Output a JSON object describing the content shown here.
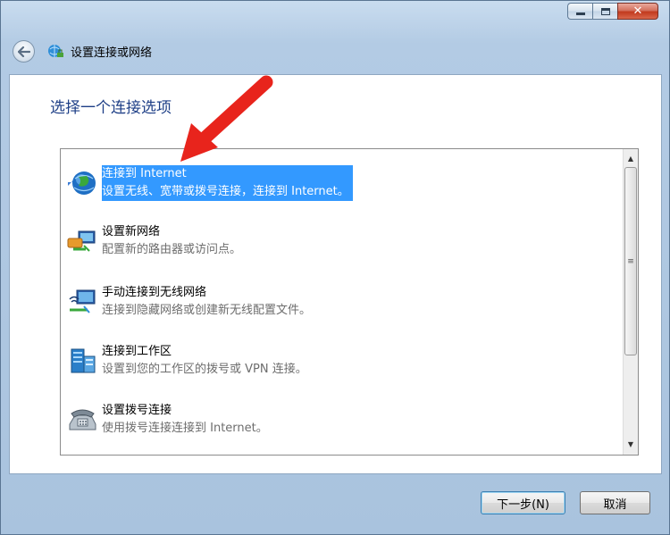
{
  "window": {
    "title": "设置连接或网络",
    "controls": {
      "minimize": "minimize-icon",
      "maximize": "maximize-icon",
      "close": "✕"
    }
  },
  "nav": {
    "back_icon": "back-arrow-icon",
    "title_icon": "network-setup-icon"
  },
  "main": {
    "heading": "选择一个连接选项",
    "options": [
      {
        "title": "连接到 Internet",
        "desc": "设置无线、宽带或拨号连接，连接到 Internet。",
        "icon": "globe-icon",
        "selected": true
      },
      {
        "title": "设置新网络",
        "desc": "配置新的路由器或访问点。",
        "icon": "router-icon",
        "selected": false
      },
      {
        "title": "手动连接到无线网络",
        "desc": "连接到隐藏网络或创建新无线配置文件。",
        "icon": "wireless-network-icon",
        "selected": false
      },
      {
        "title": "连接到工作区",
        "desc": "设置到您的工作区的拨号或 VPN 连接。",
        "icon": "workplace-icon",
        "selected": false
      },
      {
        "title": "设置拨号连接",
        "desc": "使用拨号连接连接到 Internet。",
        "icon": "phone-icon",
        "selected": false
      }
    ]
  },
  "scrollbar": {
    "up": "▲",
    "grip": "≡",
    "down": "▼"
  },
  "buttons": {
    "next": "下一步(N)",
    "cancel": "取消"
  },
  "annotation": {
    "color": "#e8241c",
    "icon": "red-arrow-pointer"
  }
}
